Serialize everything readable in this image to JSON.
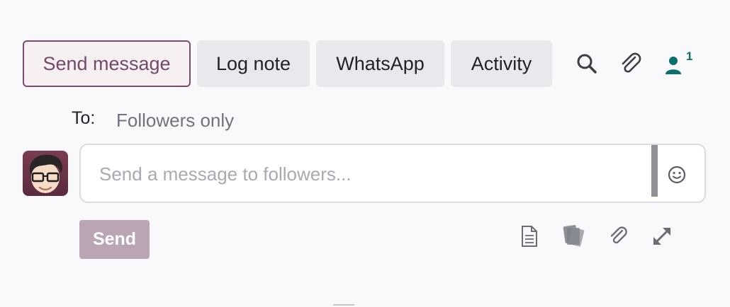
{
  "tabs": {
    "send_message": "Send message",
    "log_note": "Log note",
    "whatsapp": "WhatsApp",
    "activity": "Activity"
  },
  "toolbar": {
    "follower_count": "1",
    "icons": [
      "search-icon",
      "paperclip-icon",
      "followers-icon"
    ]
  },
  "recipients": {
    "label": "To:",
    "value": "Followers only"
  },
  "composer": {
    "placeholder": "Send a message to followers...",
    "value": ""
  },
  "actions": {
    "send_label": "Send",
    "icons": [
      "document-icon",
      "canned-responses-icon",
      "attachment-icon",
      "expand-icon"
    ]
  },
  "colors": {
    "accent": "#714b67",
    "follower": "#0a6e6b",
    "send_disabled": "#b9a5b3"
  }
}
